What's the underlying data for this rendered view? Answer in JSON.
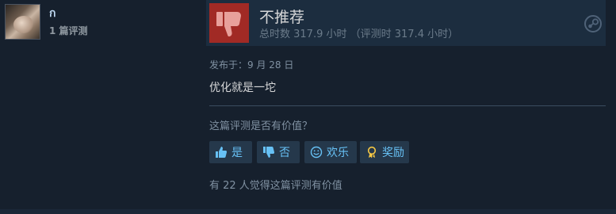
{
  "author": {
    "name": "ก",
    "reviews_count": "1 篇评测"
  },
  "review": {
    "verdict": "不推荐",
    "hours": "总时数 317.9 小时 （评测时 317.4 小时）",
    "posted": "发布于：9 月 28 日",
    "text": "优化就是一坨"
  },
  "helpful": {
    "question": "这篇评测是否有价值？",
    "yes_label": "是",
    "no_label": "否",
    "funny_label": "欢乐",
    "award_label": "奖励",
    "count_text": "有 22 人觉得这篇评测有价值"
  },
  "icons": {
    "verdict": "thumbs-down-icon",
    "platform": "steam-icon",
    "yes": "thumbs-up-icon",
    "no": "thumbs-down-icon",
    "funny": "smiley-icon",
    "award": "award-ribbon-icon"
  },
  "colors": {
    "verdict_bg": "#a12a25",
    "link_blue": "#67c1f5",
    "award_gold": "#f6c844"
  }
}
